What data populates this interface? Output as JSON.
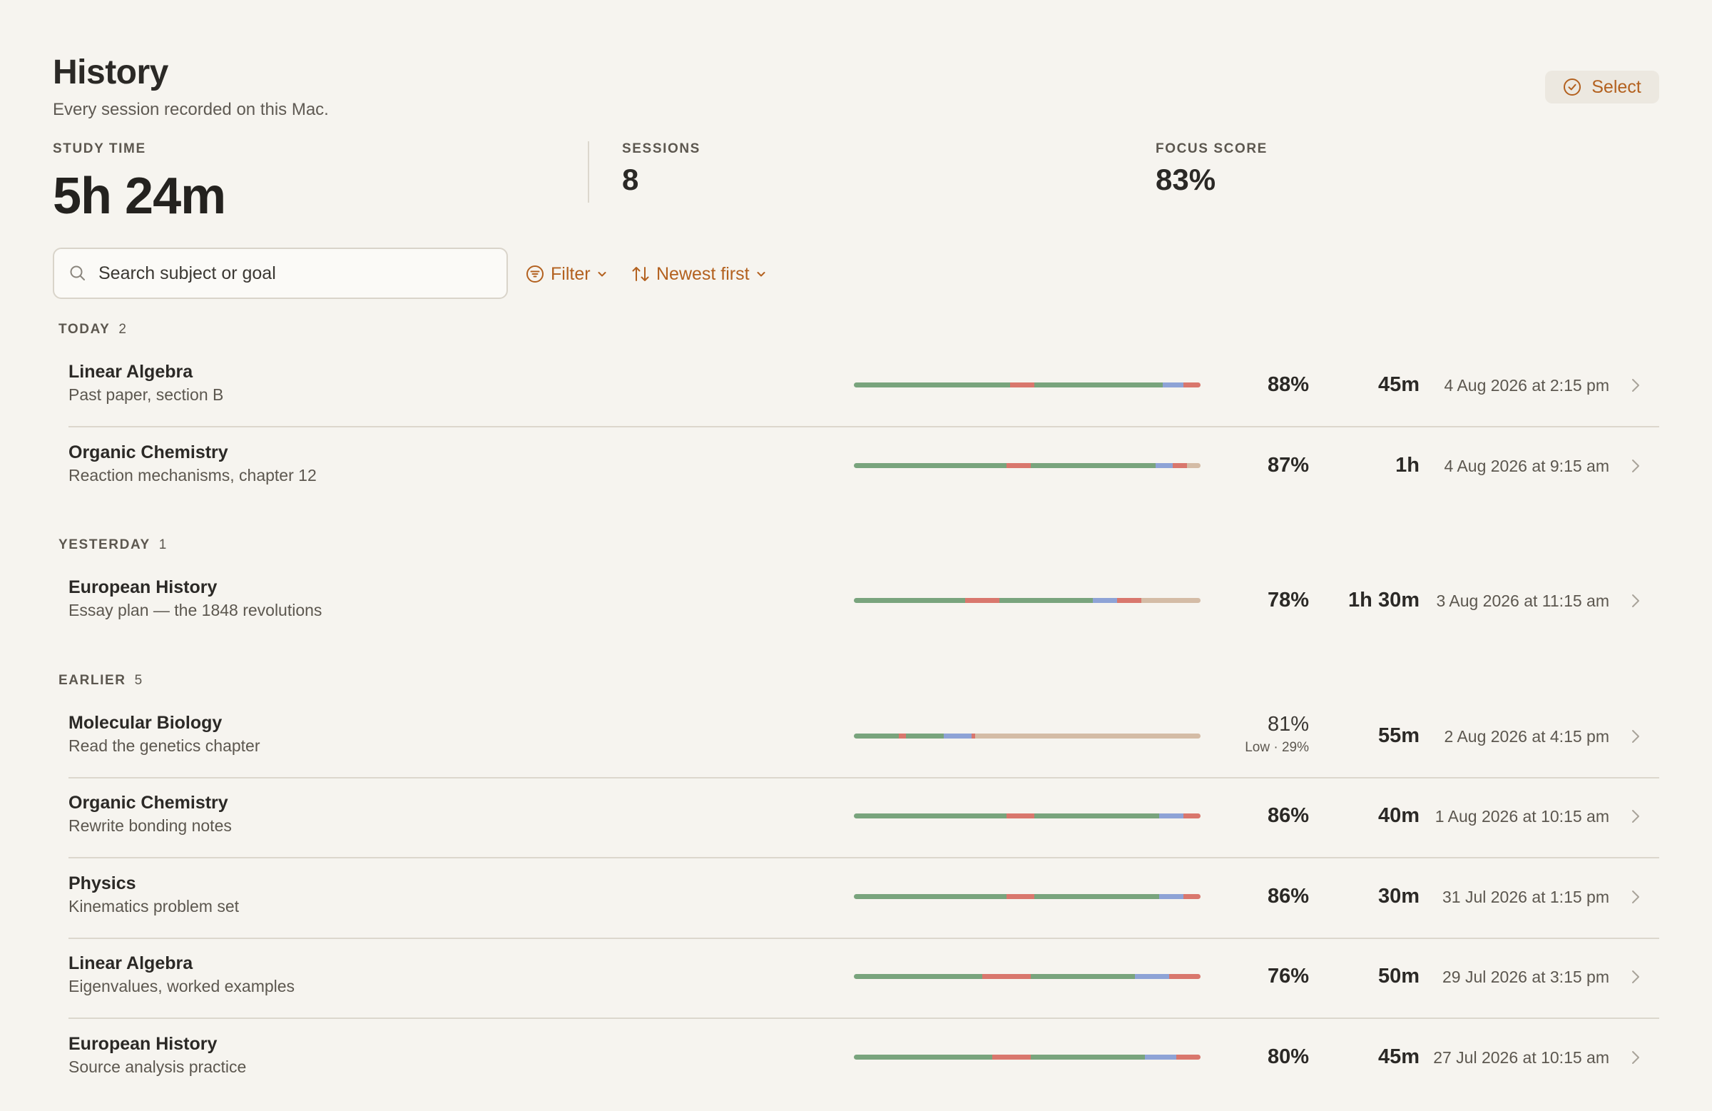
{
  "header": {
    "title": "History",
    "subtitle": "Every session recorded on this Mac.",
    "select_label": "Select"
  },
  "stats": {
    "study_time_label": "STUDY TIME",
    "study_time_value": "5h 24m",
    "sessions_label": "SESSIONS",
    "sessions_value": "8",
    "focus_label": "FOCUS SCORE",
    "focus_value": "83%"
  },
  "toolbar": {
    "search_placeholder": "Search subject or goal",
    "filter_label": "Filter",
    "sort_label": "Newest first"
  },
  "colors": {
    "background": "#f6f4ef",
    "accent": "#b3611f",
    "focus": "#79a47d",
    "distracted": "#d9776d",
    "break": "#8ea3d6",
    "idle": "#d4bca6"
  },
  "groups": [
    {
      "label": "TODAY",
      "count": "2"
    },
    {
      "label": "YESTERDAY",
      "count": "1"
    },
    {
      "label": "EARLIER",
      "count": "5"
    }
  ],
  "sessions": [
    {
      "subject": "Linear Algebra",
      "goal": "Past paper, section B",
      "score": "88%",
      "duration": "45m",
      "date": "4 Aug 2026 at 2:15 pm",
      "timeline": [
        [
          "focus",
          45
        ],
        [
          "distracted",
          7
        ],
        [
          "focus",
          37
        ],
        [
          "break",
          6
        ],
        [
          "distracted",
          5
        ]
      ]
    },
    {
      "subject": "Organic Chemistry",
      "goal": "Reaction mechanisms, chapter 12",
      "score": "87%",
      "duration": "1h",
      "date": "4 Aug 2026 at 9:15 am",
      "timeline": [
        [
          "focus",
          44
        ],
        [
          "distracted",
          7
        ],
        [
          "focus",
          36
        ],
        [
          "break",
          5
        ],
        [
          "distracted",
          4
        ],
        [
          "idle",
          4
        ]
      ]
    },
    {
      "subject": "European History",
      "goal": "Essay plan — the 1848 revolutions",
      "score": "78%",
      "duration": "1h 30m",
      "date": "3 Aug 2026 at 11:15 am",
      "timeline": [
        [
          "focus",
          32
        ],
        [
          "distracted",
          10
        ],
        [
          "focus",
          27
        ],
        [
          "break",
          7
        ],
        [
          "distracted",
          7
        ],
        [
          "idle",
          17
        ]
      ]
    },
    {
      "subject": "Molecular Biology",
      "goal": "Read the genetics chapter",
      "score": "81%",
      "score_note": "Low · 29%",
      "duration": "55m",
      "date": "2 Aug 2026 at 4:15 pm",
      "timeline": [
        [
          "focus",
          13
        ],
        [
          "distracted",
          2
        ],
        [
          "focus",
          11
        ],
        [
          "break",
          8
        ],
        [
          "distracted",
          1
        ],
        [
          "idle",
          65
        ]
      ]
    },
    {
      "subject": "Organic Chemistry",
      "goal": "Rewrite bonding notes",
      "score": "86%",
      "duration": "40m",
      "date": "1 Aug 2026 at 10:15 am",
      "timeline": [
        [
          "focus",
          44
        ],
        [
          "distracted",
          8
        ],
        [
          "focus",
          36
        ],
        [
          "break",
          7
        ],
        [
          "distracted",
          5
        ]
      ]
    },
    {
      "subject": "Physics",
      "goal": "Kinematics problem set",
      "score": "86%",
      "duration": "30m",
      "date": "31 Jul 2026 at 1:15 pm",
      "timeline": [
        [
          "focus",
          44
        ],
        [
          "distracted",
          8
        ],
        [
          "focus",
          36
        ],
        [
          "break",
          7
        ],
        [
          "distracted",
          5
        ]
      ]
    },
    {
      "subject": "Linear Algebra",
      "goal": "Eigenvalues, worked examples",
      "score": "76%",
      "duration": "50m",
      "date": "29 Jul 2026 at 3:15 pm",
      "timeline": [
        [
          "focus",
          37
        ],
        [
          "distracted",
          14
        ],
        [
          "focus",
          30
        ],
        [
          "break",
          10
        ],
        [
          "distracted",
          9
        ]
      ]
    },
    {
      "subject": "European History",
      "goal": "Source analysis practice",
      "score": "80%",
      "duration": "45m",
      "date": "27 Jul 2026 at 10:15 am",
      "timeline": [
        [
          "focus",
          40
        ],
        [
          "distracted",
          11
        ],
        [
          "focus",
          33
        ],
        [
          "break",
          9
        ],
        [
          "distracted",
          7
        ]
      ]
    }
  ]
}
